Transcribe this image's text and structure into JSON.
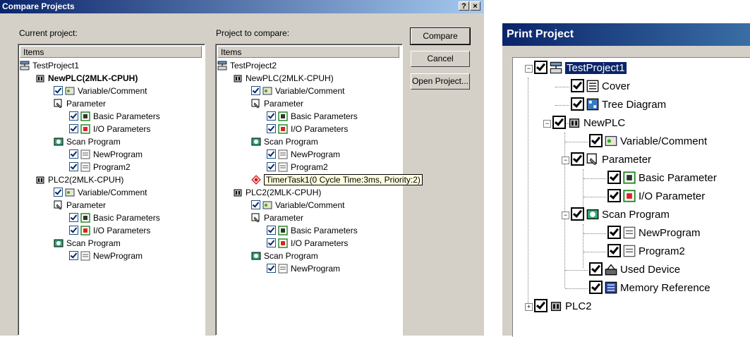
{
  "compare": {
    "title": "Compare Projects",
    "help_btn": "?",
    "close_btn": "×",
    "current_label": "Current project:",
    "compare_label": "Project to compare:",
    "items_header": "Items",
    "buttons": {
      "compare": "Compare",
      "cancel": "Cancel",
      "open": "Open Project..."
    },
    "left_tree": [
      "TestProject1",
      "NewPLC(2MLK-CPUH)",
      "Variable/Comment",
      "Parameter",
      "Basic Parameters",
      "I/O Parameters",
      "Scan Program",
      "NewProgram",
      "Program2",
      "PLC2(2MLK-CPUH)",
      "Variable/Comment",
      "Parameter",
      "Basic Parameters",
      "I/O Parameters",
      "Scan Program",
      "NewProgram"
    ],
    "right_tree": [
      "TestProject2",
      "NewPLC(2MLK-CPUH)",
      "Variable/Comment",
      "Parameter",
      "Basic Parameters",
      "I/O Parameters",
      "Scan Program",
      "NewProgram",
      "Program2",
      "TimerTask1(0 Cycle Time:3ms, Priority:2)",
      "PLC2(2MLK-CPUH)",
      "Variable/Comment",
      "Parameter",
      "Basic Parameters",
      "I/O Parameters",
      "Scan Program",
      "NewProgram"
    ]
  },
  "print": {
    "title": "Print Project",
    "tree": [
      "TestProject1",
      "Cover",
      "Tree Diagram",
      "NewPLC",
      "Variable/Comment",
      "Parameter",
      "Basic Parameter",
      "I/O Parameter",
      "Scan Program",
      "NewProgram",
      "Program2",
      "Used Device",
      "Memory Reference",
      "PLC2"
    ],
    "expanders": {
      "collapse": "−",
      "expand": "+"
    }
  }
}
